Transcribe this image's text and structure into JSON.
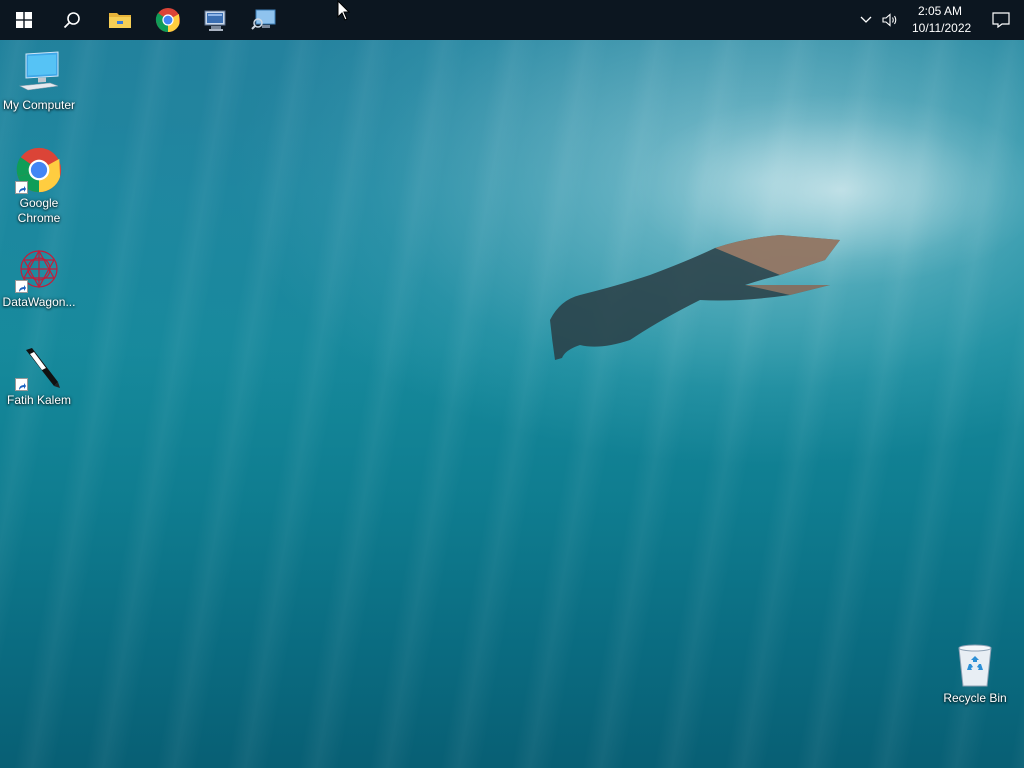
{
  "taskbar": {
    "start": {
      "icon": "windows-logo-icon"
    },
    "search": {
      "icon": "search-icon"
    },
    "pinned": [
      {
        "name": "file-explorer",
        "icon": "folder-icon"
      },
      {
        "name": "google-chrome",
        "icon": "chrome-icon"
      },
      {
        "name": "network-connections",
        "icon": "network-computer-icon"
      },
      {
        "name": "remote-desktop",
        "icon": "monitor-search-icon"
      }
    ],
    "tray": {
      "overflow_icon": "chevron-up-icon",
      "volume_icon": "speaker-icon",
      "time": "2:05 AM",
      "date": "10/11/2022",
      "notifications_icon": "action-center-icon"
    }
  },
  "desktop": {
    "icons": [
      {
        "label": "My Computer",
        "icon": "computer-icon",
        "shortcut": false
      },
      {
        "label": "Google\nChrome",
        "icon": "chrome-icon",
        "shortcut": true
      },
      {
        "label": "DataWagon...",
        "icon": "datawagon-icon",
        "shortcut": true
      },
      {
        "label": "Fatih Kalem",
        "icon": "pen-icon",
        "shortcut": true
      },
      {
        "label": "Recycle Bin",
        "icon": "recycle-bin-icon",
        "shortcut": false
      }
    ],
    "wallpaper": "underwater-freediver",
    "colors": {
      "water": "#168a9c",
      "taskbar": "#0c1620"
    }
  }
}
